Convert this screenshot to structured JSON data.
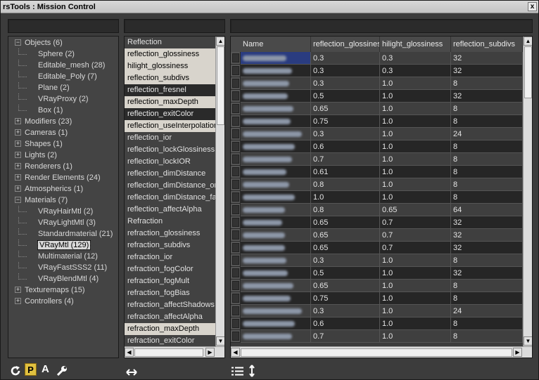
{
  "window": {
    "title": "rsTools : Mission Control",
    "close_label": "x"
  },
  "tree": {
    "items": [
      {
        "label": "Objects (6)",
        "level": 0,
        "expander": "−"
      },
      {
        "label": "Sphere (2)",
        "level": 1
      },
      {
        "label": "Editable_mesh (28)",
        "level": 1
      },
      {
        "label": "Editable_Poly (7)",
        "level": 1
      },
      {
        "label": "Plane (2)",
        "level": 1
      },
      {
        "label": "VRayProxy (2)",
        "level": 1
      },
      {
        "label": "Box (1)",
        "level": 1
      },
      {
        "label": "Modifiers (23)",
        "level": 0,
        "expander": "+"
      },
      {
        "label": "Cameras (1)",
        "level": 0,
        "expander": "+"
      },
      {
        "label": "Shapes (1)",
        "level": 0,
        "expander": "+"
      },
      {
        "label": "Lights (2)",
        "level": 0,
        "expander": "+"
      },
      {
        "label": "Renderers (1)",
        "level": 0,
        "expander": "+"
      },
      {
        "label": "Render Elements (24)",
        "level": 0,
        "expander": "+"
      },
      {
        "label": "Atmospherics (1)",
        "level": 0,
        "expander": "+"
      },
      {
        "label": "Materials (7)",
        "level": 0,
        "expander": "−"
      },
      {
        "label": "VRayHairMtl (2)",
        "level": 1
      },
      {
        "label": "VRayLightMtl (3)",
        "level": 1
      },
      {
        "label": "Standardmaterial (21)",
        "level": 1
      },
      {
        "label": "VRayMtl (129)",
        "level": 1,
        "selected": true
      },
      {
        "label": "Multimaterial (12)",
        "level": 1
      },
      {
        "label": "VRayFastSSS2 (11)",
        "level": 1
      },
      {
        "label": "VRayBlendMtl (4)",
        "level": 1
      },
      {
        "label": "Texturemaps (15)",
        "level": 0,
        "expander": "+"
      },
      {
        "label": "Controllers (4)",
        "level": 0,
        "expander": "+"
      }
    ]
  },
  "properties": {
    "items": [
      {
        "label": "Reflection",
        "state": "plain"
      },
      {
        "label": "reflection_glossiness",
        "state": "on"
      },
      {
        "label": "hilight_glossiness",
        "state": "on"
      },
      {
        "label": "reflection_subdivs",
        "state": "on"
      },
      {
        "label": "reflection_fresnel",
        "state": "dk"
      },
      {
        "label": "reflection_maxDepth",
        "state": "on"
      },
      {
        "label": "reflection_exitColor",
        "state": "dk"
      },
      {
        "label": "reflection_useInterpolation",
        "state": "on"
      },
      {
        "label": "reflection_ior",
        "state": "plain"
      },
      {
        "label": "reflection_lockGlossiness",
        "state": "plain"
      },
      {
        "label": "reflection_lockIOR",
        "state": "plain"
      },
      {
        "label": "reflection_dimDistance",
        "state": "plain"
      },
      {
        "label": "reflection_dimDistance_on",
        "state": "plain"
      },
      {
        "label": "reflection_dimDistance_falloff",
        "state": "plain"
      },
      {
        "label": "reflection_affectAlpha",
        "state": "plain"
      },
      {
        "label": "Refraction",
        "state": "plain"
      },
      {
        "label": "refraction_glossiness",
        "state": "plain"
      },
      {
        "label": "refraction_subdivs",
        "state": "plain"
      },
      {
        "label": "refraction_ior",
        "state": "plain"
      },
      {
        "label": "refraction_fogColor",
        "state": "plain"
      },
      {
        "label": "refraction_fogMult",
        "state": "plain"
      },
      {
        "label": "refraction_fogBias",
        "state": "plain"
      },
      {
        "label": "refraction_affectShadows",
        "state": "plain"
      },
      {
        "label": "refraction_affectAlpha",
        "state": "plain"
      },
      {
        "label": "refraction_maxDepth",
        "state": "on"
      },
      {
        "label": "refraction_exitColor",
        "state": "plain"
      }
    ]
  },
  "grid": {
    "columns": [
      "Name",
      "reflection_glossiness",
      "hilight_glossiness",
      "reflection_subdivs"
    ],
    "rows": [
      {
        "a": "0.3",
        "b": "0.3",
        "c": "32",
        "w": 62,
        "sel": true
      },
      {
        "a": "0.3",
        "b": "0.3",
        "c": "32",
        "w": 70
      },
      {
        "a": "0.3",
        "b": "1.0",
        "c": "8",
        "w": 66
      },
      {
        "a": "0.5",
        "b": "1.0",
        "c": "32",
        "w": 64
      },
      {
        "a": "0.65",
        "b": "1.0",
        "c": "8",
        "w": 72
      },
      {
        "a": "0.75",
        "b": "1.0",
        "c": "8",
        "w": 68
      },
      {
        "a": "0.3",
        "b": "1.0",
        "c": "24",
        "w": 84
      },
      {
        "a": "0.6",
        "b": "1.0",
        "c": "8",
        "w": 74
      },
      {
        "a": "0.7",
        "b": "1.0",
        "c": "8",
        "w": 70
      },
      {
        "a": "0.61",
        "b": "1.0",
        "c": "8",
        "w": 62
      },
      {
        "a": "0.8",
        "b": "1.0",
        "c": "8",
        "w": 66
      },
      {
        "a": "1.0",
        "b": "1.0",
        "c": "8",
        "w": 74
      },
      {
        "a": "0.8",
        "b": "0.65",
        "c": "64",
        "w": 60
      },
      {
        "a": "0.65",
        "b": "0.7",
        "c": "32",
        "w": 56
      },
      {
        "a": "0.65",
        "b": "0.7",
        "c": "32",
        "w": 60
      },
      {
        "a": "0.65",
        "b": "0.7",
        "c": "32",
        "w": 60
      },
      {
        "a": "0.3",
        "b": "1.0",
        "c": "8",
        "w": 62
      },
      {
        "a": "0.5",
        "b": "1.0",
        "c": "32",
        "w": 64
      },
      {
        "a": "0.65",
        "b": "1.0",
        "c": "8",
        "w": 72
      },
      {
        "a": "0.75",
        "b": "1.0",
        "c": "8",
        "w": 68
      },
      {
        "a": "0.3",
        "b": "1.0",
        "c": "24",
        "w": 84
      },
      {
        "a": "0.6",
        "b": "1.0",
        "c": "8",
        "w": 74
      },
      {
        "a": "0.7",
        "b": "1.0",
        "c": "8",
        "w": 70
      }
    ]
  },
  "bottombar": {
    "refresh_icon": "refresh-icon",
    "p_label": "P",
    "a_label": "A",
    "settings_icon": "wrench-icon",
    "swap_icon": "left-right-arrow-icon",
    "list_icon": "list-icon",
    "sort_icon": "up-down-arrow-icon"
  }
}
